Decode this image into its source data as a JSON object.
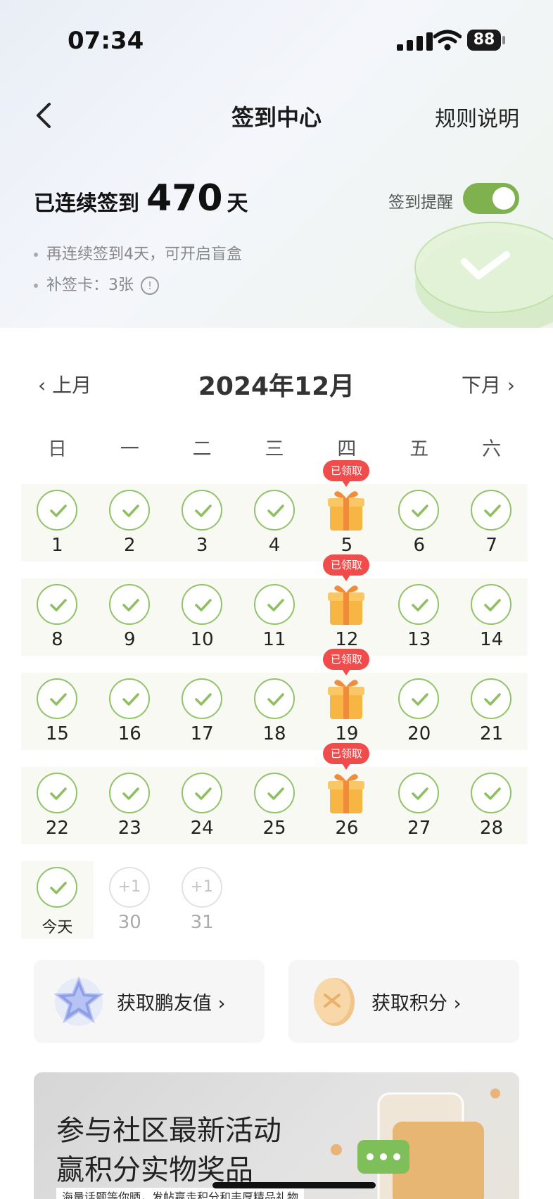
{
  "status_bar": {
    "time": "07:34",
    "battery": "88"
  },
  "nav": {
    "title": "签到中心",
    "rules": "规则说明"
  },
  "streak": {
    "prefix": "已连续签到",
    "count": "470",
    "suffix": "天"
  },
  "reminder": {
    "label": "签到提醒",
    "enabled": true
  },
  "tips": [
    "再连续签到4天，可开启盲盒",
    "补签卡：3张"
  ],
  "calendar": {
    "prev_label": "上月",
    "next_label": "下月",
    "month": "2024年12月",
    "weekdays": [
      "日",
      "一",
      "二",
      "三",
      "四",
      "五",
      "六"
    ],
    "badge_label": "已领取",
    "weeks": [
      [
        "1",
        "2",
        "3",
        "4",
        "5",
        "6",
        "7"
      ],
      [
        "8",
        "9",
        "10",
        "11",
        "12",
        "13",
        "14"
      ],
      [
        "15",
        "16",
        "17",
        "18",
        "19",
        "20",
        "21"
      ],
      [
        "22",
        "23",
        "24",
        "25",
        "26",
        "27",
        "28"
      ]
    ],
    "gift_days": [
      "5",
      "12",
      "19",
      "26"
    ],
    "today_label": "今天",
    "future_days": [
      {
        "day": "30",
        "reward": "+1"
      },
      {
        "day": "31",
        "reward": "+1"
      }
    ]
  },
  "cards": [
    {
      "label": "获取鹏友值",
      "icon": "star-icon"
    },
    {
      "label": "获取积分",
      "icon": "coin-icon"
    }
  ],
  "banner": {
    "line1": "参与社区最新活动",
    "line2": "赢积分实物奖品",
    "sub": "海量话题等你晒，发帖赢走积分和丰厚精品礼物"
  },
  "colors": {
    "accent_green": "#7fb24e",
    "check_green": "#92c36a",
    "badge_red": "#f14c4c",
    "gift_orange": "#f7b544"
  }
}
